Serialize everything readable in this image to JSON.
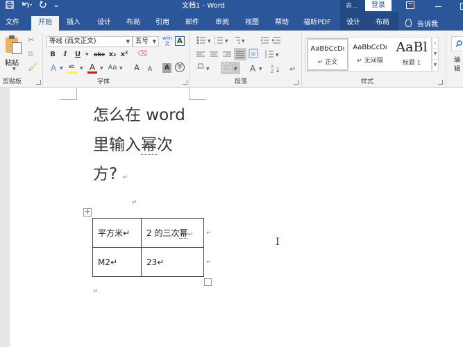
{
  "titlebar": {
    "title": "文档1  -  Word",
    "context_tab_group": "表...",
    "login_label": "登录",
    "qat": {
      "save_icon": "save-icon",
      "undo_icon": "undo-icon",
      "redo_icon": "redo-icon",
      "customize_icon": "customize-qat-icon"
    }
  },
  "tabs": [
    {
      "label": "文件"
    },
    {
      "label": "开始",
      "active": true
    },
    {
      "label": "插入"
    },
    {
      "label": "设计"
    },
    {
      "label": "布局"
    },
    {
      "label": "引用"
    },
    {
      "label": "邮件"
    },
    {
      "label": "审阅"
    },
    {
      "label": "视图"
    },
    {
      "label": "帮助"
    },
    {
      "label": "福昕PDF"
    },
    {
      "label": "设计",
      "contextual": true
    },
    {
      "label": "布局",
      "contextual": true
    }
  ],
  "tell_me": "告诉我",
  "ribbon": {
    "clipboard": {
      "label": "剪贴板",
      "paste_label": "粘贴"
    },
    "font": {
      "label": "字体",
      "font_name": "等线 (西文正文)",
      "font_size": "五号",
      "bold": "B",
      "italic": "I",
      "underline": "U",
      "strike": "abc",
      "subscript": "x₂",
      "superscript": "x²",
      "grow": "A",
      "shrink": "A",
      "case": "Aa",
      "highlight_color": "#ffff00",
      "font_color": "#ff0000"
    },
    "paragraph": {
      "label": "段落"
    },
    "styles": {
      "label": "样式",
      "items": [
        {
          "preview": "AaBbCcDı",
          "name": "↵ 正文",
          "selected": true
        },
        {
          "preview": "AaBbCcDı",
          "name": "↵ 无间隔"
        },
        {
          "preview": "AaBl",
          "name": "标题 1"
        }
      ]
    },
    "editing": {
      "label": "编辑"
    }
  },
  "document": {
    "heading_lines": [
      "怎么在 word",
      "里输入",
      "幂",
      "次",
      "方?"
    ],
    "empty_para_mark": "↵",
    "table": {
      "rows": [
        [
          "平方米↵",
          "2 的三次",
          "幂",
          "↵"
        ],
        [
          "M2↵",
          "23↵"
        ]
      ]
    }
  }
}
